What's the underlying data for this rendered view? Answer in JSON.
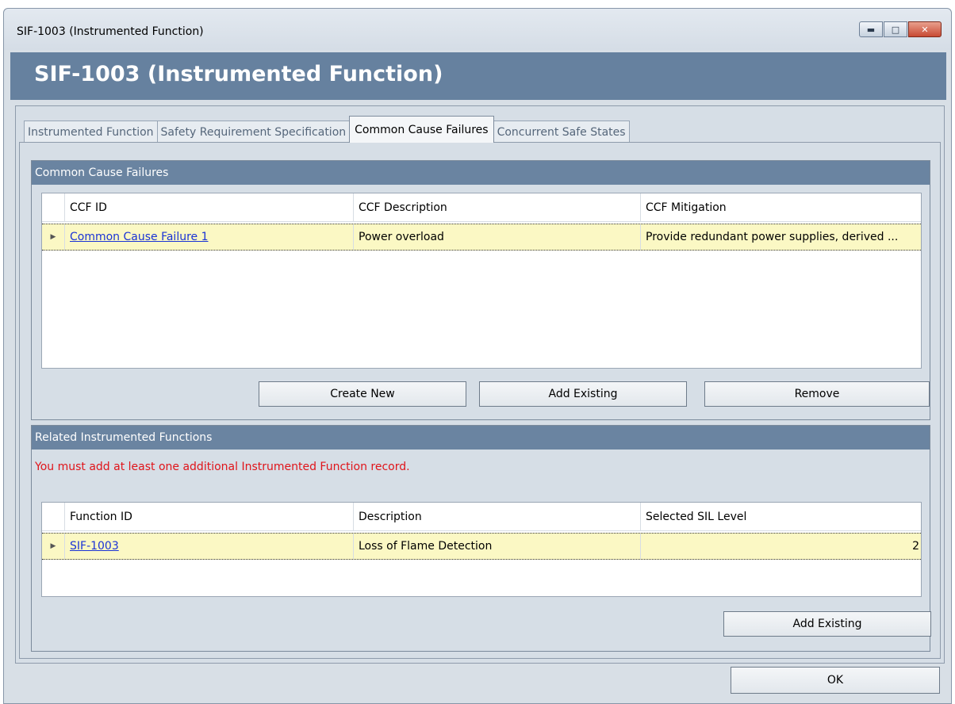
{
  "window": {
    "title": "SIF-1003 (Instrumented Function)",
    "controls": {
      "minimize": "▬",
      "maximize": "□",
      "close": "✕"
    }
  },
  "banner": {
    "title": "SIF-1003 (Instrumented Function)"
  },
  "tabs": [
    {
      "label": "Instrumented Function",
      "active": false
    },
    {
      "label": "Safety Requirement Specification",
      "active": false
    },
    {
      "label": "Common Cause Failures",
      "active": true
    },
    {
      "label": "Concurrent Safe States",
      "active": false
    }
  ],
  "ccf_group": {
    "title": "Common Cause Failures",
    "columns": [
      "CCF ID",
      "CCF Description",
      "CCF Mitigation"
    ],
    "rows": [
      {
        "id": "Common Cause Failure 1",
        "description": "Power overload",
        "mitigation": "Provide redundant power supplies, derived ..."
      }
    ],
    "buttons": {
      "create_new": "Create New",
      "add_existing": "Add Existing",
      "remove": "Remove"
    }
  },
  "rif_group": {
    "title": "Related Instrumented Functions",
    "warning": "You must add at least one additional Instrumented Function record.",
    "columns": [
      "Function ID",
      "Description",
      "Selected SIL Level"
    ],
    "rows": [
      {
        "function_id": "SIF-1003",
        "description": "Loss of Flame Detection",
        "sil_level": "2"
      }
    ],
    "buttons": {
      "add_existing": "Add Existing"
    }
  },
  "footer": {
    "ok": "OK"
  },
  "colors": {
    "banner": "#66819f",
    "group_header": "#6a84a1",
    "selected_row": "#fbf8c4",
    "warning": "#e0141a",
    "link": "#1a33d6"
  }
}
